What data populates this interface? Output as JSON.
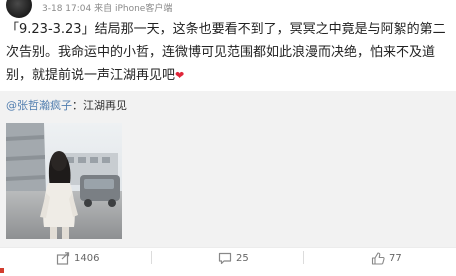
{
  "post": {
    "meta": "3-18 17:04 来自 iPhone客户端",
    "text_lines": [
      "「9.23-3.23」结局那一天，这条也要看不到了，冥冥之中竟是与阿絮的第二",
      "次告别。我命运中的小哲，连微博可见范围都如此浪漫而决绝，怕来不及道",
      "别，就提前说一声江湖再见吧"
    ]
  },
  "repost": {
    "mention": "@张哲瀚疯子",
    "text": "：江湖再见"
  },
  "actions": {
    "repost_count": "1406",
    "comment_count": "25",
    "like_count": "77"
  },
  "colors": {
    "link": "#507daf",
    "heart": "#e0263a",
    "repost_bg": "#f2f2f2"
  },
  "icons": [
    "heart-emoji",
    "repost-icon",
    "comment-icon",
    "like-icon"
  ]
}
